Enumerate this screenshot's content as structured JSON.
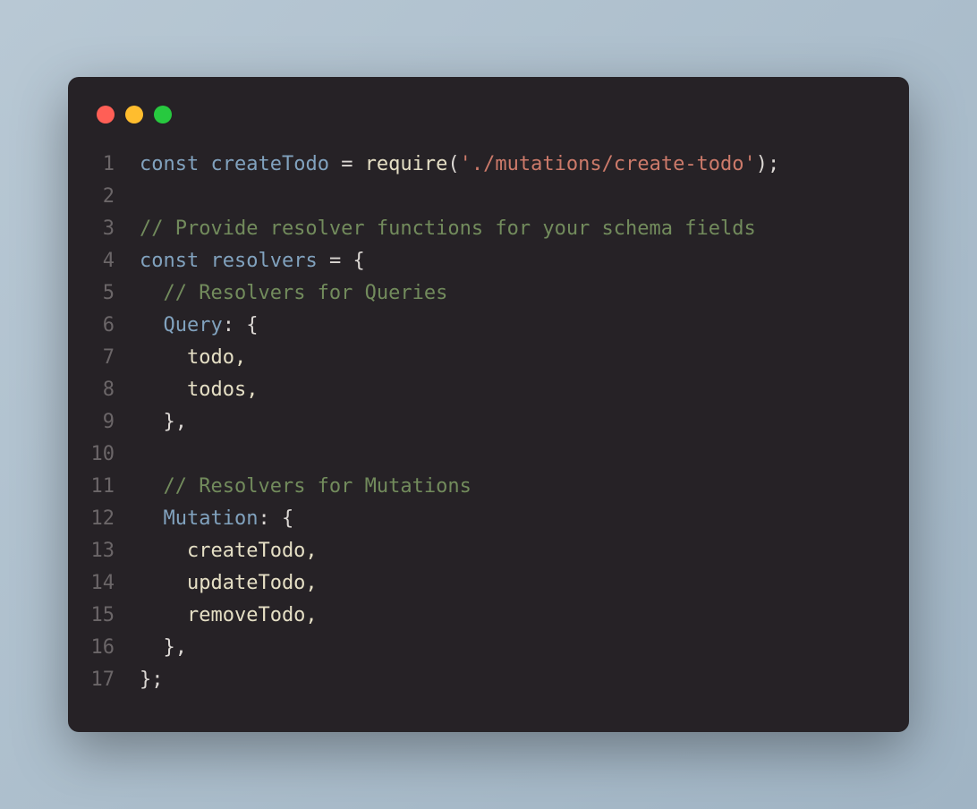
{
  "window": {
    "buttons": [
      "close",
      "minimize",
      "zoom"
    ]
  },
  "syntax": {
    "keyword": "tok-keyword",
    "def": "tok-def",
    "func": "tok-func",
    "ident": "tok-ident",
    "punct": "tok-punct",
    "op": "tok-op",
    "string": "tok-string",
    "comment": "tok-comment",
    "prop": "tok-prop"
  },
  "code": {
    "lines": [
      {
        "n": "1",
        "tokens": [
          {
            "t": "const ",
            "c": "keyword"
          },
          {
            "t": "createTodo",
            "c": "def"
          },
          {
            "t": " ",
            "c": "punct"
          },
          {
            "t": "=",
            "c": "op"
          },
          {
            "t": " ",
            "c": "punct"
          },
          {
            "t": "require",
            "c": "func"
          },
          {
            "t": "(",
            "c": "punct"
          },
          {
            "t": "'./mutations/create-todo'",
            "c": "string"
          },
          {
            "t": ");",
            "c": "punct"
          }
        ]
      },
      {
        "n": "2",
        "tokens": []
      },
      {
        "n": "3",
        "tokens": [
          {
            "t": "// Provide resolver functions for your schema fields",
            "c": "comment"
          }
        ]
      },
      {
        "n": "4",
        "tokens": [
          {
            "t": "const ",
            "c": "keyword"
          },
          {
            "t": "resolvers",
            "c": "def"
          },
          {
            "t": " ",
            "c": "punct"
          },
          {
            "t": "=",
            "c": "op"
          },
          {
            "t": " {",
            "c": "punct"
          }
        ]
      },
      {
        "n": "5",
        "tokens": [
          {
            "t": "  ",
            "c": "punct"
          },
          {
            "t": "// Resolvers for Queries",
            "c": "comment"
          }
        ]
      },
      {
        "n": "6",
        "tokens": [
          {
            "t": "  ",
            "c": "punct"
          },
          {
            "t": "Query",
            "c": "prop"
          },
          {
            "t": ": {",
            "c": "punct"
          }
        ]
      },
      {
        "n": "7",
        "tokens": [
          {
            "t": "    todo,",
            "c": "ident"
          }
        ]
      },
      {
        "n": "8",
        "tokens": [
          {
            "t": "    todos,",
            "c": "ident"
          }
        ]
      },
      {
        "n": "9",
        "tokens": [
          {
            "t": "  },",
            "c": "punct"
          }
        ]
      },
      {
        "n": "10",
        "tokens": []
      },
      {
        "n": "11",
        "tokens": [
          {
            "t": "  ",
            "c": "punct"
          },
          {
            "t": "// Resolvers for Mutations",
            "c": "comment"
          }
        ]
      },
      {
        "n": "12",
        "tokens": [
          {
            "t": "  ",
            "c": "punct"
          },
          {
            "t": "Mutation",
            "c": "prop"
          },
          {
            "t": ": {",
            "c": "punct"
          }
        ]
      },
      {
        "n": "13",
        "tokens": [
          {
            "t": "    createTodo,",
            "c": "ident"
          }
        ]
      },
      {
        "n": "14",
        "tokens": [
          {
            "t": "    updateTodo,",
            "c": "ident"
          }
        ]
      },
      {
        "n": "15",
        "tokens": [
          {
            "t": "    removeTodo,",
            "c": "ident"
          }
        ]
      },
      {
        "n": "16",
        "tokens": [
          {
            "t": "  },",
            "c": "punct"
          }
        ]
      },
      {
        "n": "17",
        "tokens": [
          {
            "t": "};",
            "c": "punct"
          }
        ]
      }
    ]
  }
}
